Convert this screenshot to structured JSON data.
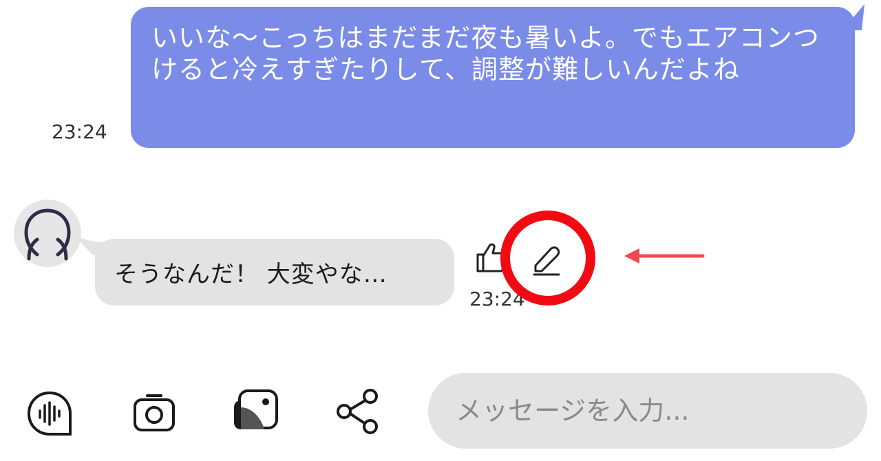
{
  "sent_message": {
    "text": "いいな〜こっちはまだまだ夜も暑いよ。でもエアコンつけると冷えすぎたりして、調整が難しいんだよね",
    "time": "23:24"
  },
  "received_message": {
    "text": "そうなんだ！ 大変やな…",
    "time": "23:24"
  },
  "composer": {
    "placeholder": "メッセージを入力..."
  },
  "icons": {
    "avatar": "person-icon",
    "like": "thumbs-up-icon",
    "edit": "pencil-icon",
    "voice": "voice-message-icon",
    "camera": "camera-icon",
    "gallery": "gallery-icon",
    "share": "share-icon"
  },
  "colors": {
    "sent_bubble": "#7a8be8",
    "received_bubble": "#e3e3e3",
    "annotation": "#f20a12"
  }
}
